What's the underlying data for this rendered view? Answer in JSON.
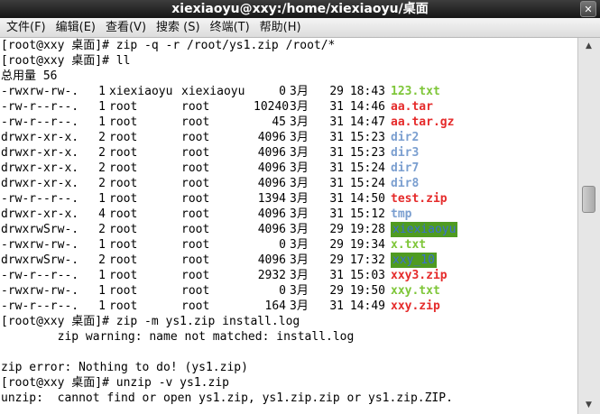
{
  "window": {
    "title": "xiexiaoyu@xxy:/home/xiexiaoyu/桌面",
    "close_icon": "✕"
  },
  "menu": [
    "文件(F)",
    "编辑(E)",
    "查看(V)",
    "搜索 (S)",
    "终端(T)",
    "帮助(H)"
  ],
  "colors": {
    "green": "#7ec638",
    "red": "#e52b2b",
    "blue": "#7b9fd0",
    "highlight_bg": "#4f9b21",
    "highlight_fg": "#3a6fd1"
  },
  "terminal": {
    "cmd1": "[root@xxy 桌面]# zip -q -r /root/ys1.zip /root/*",
    "cmd2": "[root@xxy 桌面]# ll",
    "total": "总用量 56",
    "files": [
      {
        "perm": "-rwxrw-rw-.",
        "links": "1",
        "owner": "xiexiaoyu",
        "group": "xiexiaoyu",
        "size": "0",
        "month": "3月",
        "day": "29",
        "time": "18:43",
        "name": "123.txt",
        "style": "green"
      },
      {
        "perm": "-rw-r--r--.",
        "links": "1",
        "owner": "root",
        "group": "root",
        "size": "10240",
        "month": "3月",
        "day": "31",
        "time": "14:46",
        "name": "aa.tar",
        "style": "red"
      },
      {
        "perm": "-rw-r--r--.",
        "links": "1",
        "owner": "root",
        "group": "root",
        "size": "45",
        "month": "3月",
        "day": "31",
        "time": "14:47",
        "name": "aa.tar.gz",
        "style": "red"
      },
      {
        "perm": "drwxr-xr-x.",
        "links": "2",
        "owner": "root",
        "group": "root",
        "size": "4096",
        "month": "3月",
        "day": "31",
        "time": "15:23",
        "name": "dir2",
        "style": "blue"
      },
      {
        "perm": "drwxr-xr-x.",
        "links": "2",
        "owner": "root",
        "group": "root",
        "size": "4096",
        "month": "3月",
        "day": "31",
        "time": "15:23",
        "name": "dir3",
        "style": "blue"
      },
      {
        "perm": "drwxr-xr-x.",
        "links": "2",
        "owner": "root",
        "group": "root",
        "size": "4096",
        "month": "3月",
        "day": "31",
        "time": "15:24",
        "name": "dir7",
        "style": "blue"
      },
      {
        "perm": "drwxr-xr-x.",
        "links": "2",
        "owner": "root",
        "group": "root",
        "size": "4096",
        "month": "3月",
        "day": "31",
        "time": "15:24",
        "name": "dir8",
        "style": "blue"
      },
      {
        "perm": "-rw-r--r--.",
        "links": "1",
        "owner": "root",
        "group": "root",
        "size": "1394",
        "month": "3月",
        "day": "31",
        "time": "14:50",
        "name": "test.zip",
        "style": "red"
      },
      {
        "perm": "drwxr-xr-x.",
        "links": "4",
        "owner": "root",
        "group": "root",
        "size": "4096",
        "month": "3月",
        "day": "31",
        "time": "15:12",
        "name": "tmp",
        "style": "blue"
      },
      {
        "perm": "drwxrwSrw-.",
        "links": "2",
        "owner": "root",
        "group": "root",
        "size": "4096",
        "month": "3月",
        "day": "29",
        "time": "19:28",
        "name": "xiexiaoyu",
        "style": "hl"
      },
      {
        "perm": "-rwxrw-rw-.",
        "links": "1",
        "owner": "root",
        "group": "root",
        "size": "0",
        "month": "3月",
        "day": "29",
        "time": "19:34",
        "name": "x.txt",
        "style": "green"
      },
      {
        "perm": "drwxrwSrw-.",
        "links": "2",
        "owner": "root",
        "group": "root",
        "size": "4096",
        "month": "3月",
        "day": "29",
        "time": "17:32",
        "name": "xxy_10",
        "style": "hl"
      },
      {
        "perm": "-rw-r--r--.",
        "links": "1",
        "owner": "root",
        "group": "root",
        "size": "2932",
        "month": "3月",
        "day": "31",
        "time": "15:03",
        "name": "xxy3.zip",
        "style": "red"
      },
      {
        "perm": "-rwxrw-rw-.",
        "links": "1",
        "owner": "root",
        "group": "root",
        "size": "0",
        "month": "3月",
        "day": "29",
        "time": "19:50",
        "name": "xxy.txt",
        "style": "green"
      },
      {
        "perm": "-rw-r--r--.",
        "links": "1",
        "owner": "root",
        "group": "root",
        "size": "164",
        "month": "3月",
        "day": "31",
        "time": "14:49",
        "name": "xxy.zip",
        "style": "red"
      }
    ],
    "cmd3": "[root@xxy 桌面]# zip -m ys1.zip install.log",
    "warning": "        zip warning: name not matched: install.log",
    "error": "zip error: Nothing to do! (ys1.zip)",
    "cmd4": "[root@xxy 桌面]# unzip -v ys1.zip",
    "unzip_err": "unzip:  cannot find or open ys1.zip, ys1.zip.zip or ys1.zip.ZIP."
  },
  "scrollbar": {
    "up_icon": "▲",
    "down_icon": "▼"
  }
}
